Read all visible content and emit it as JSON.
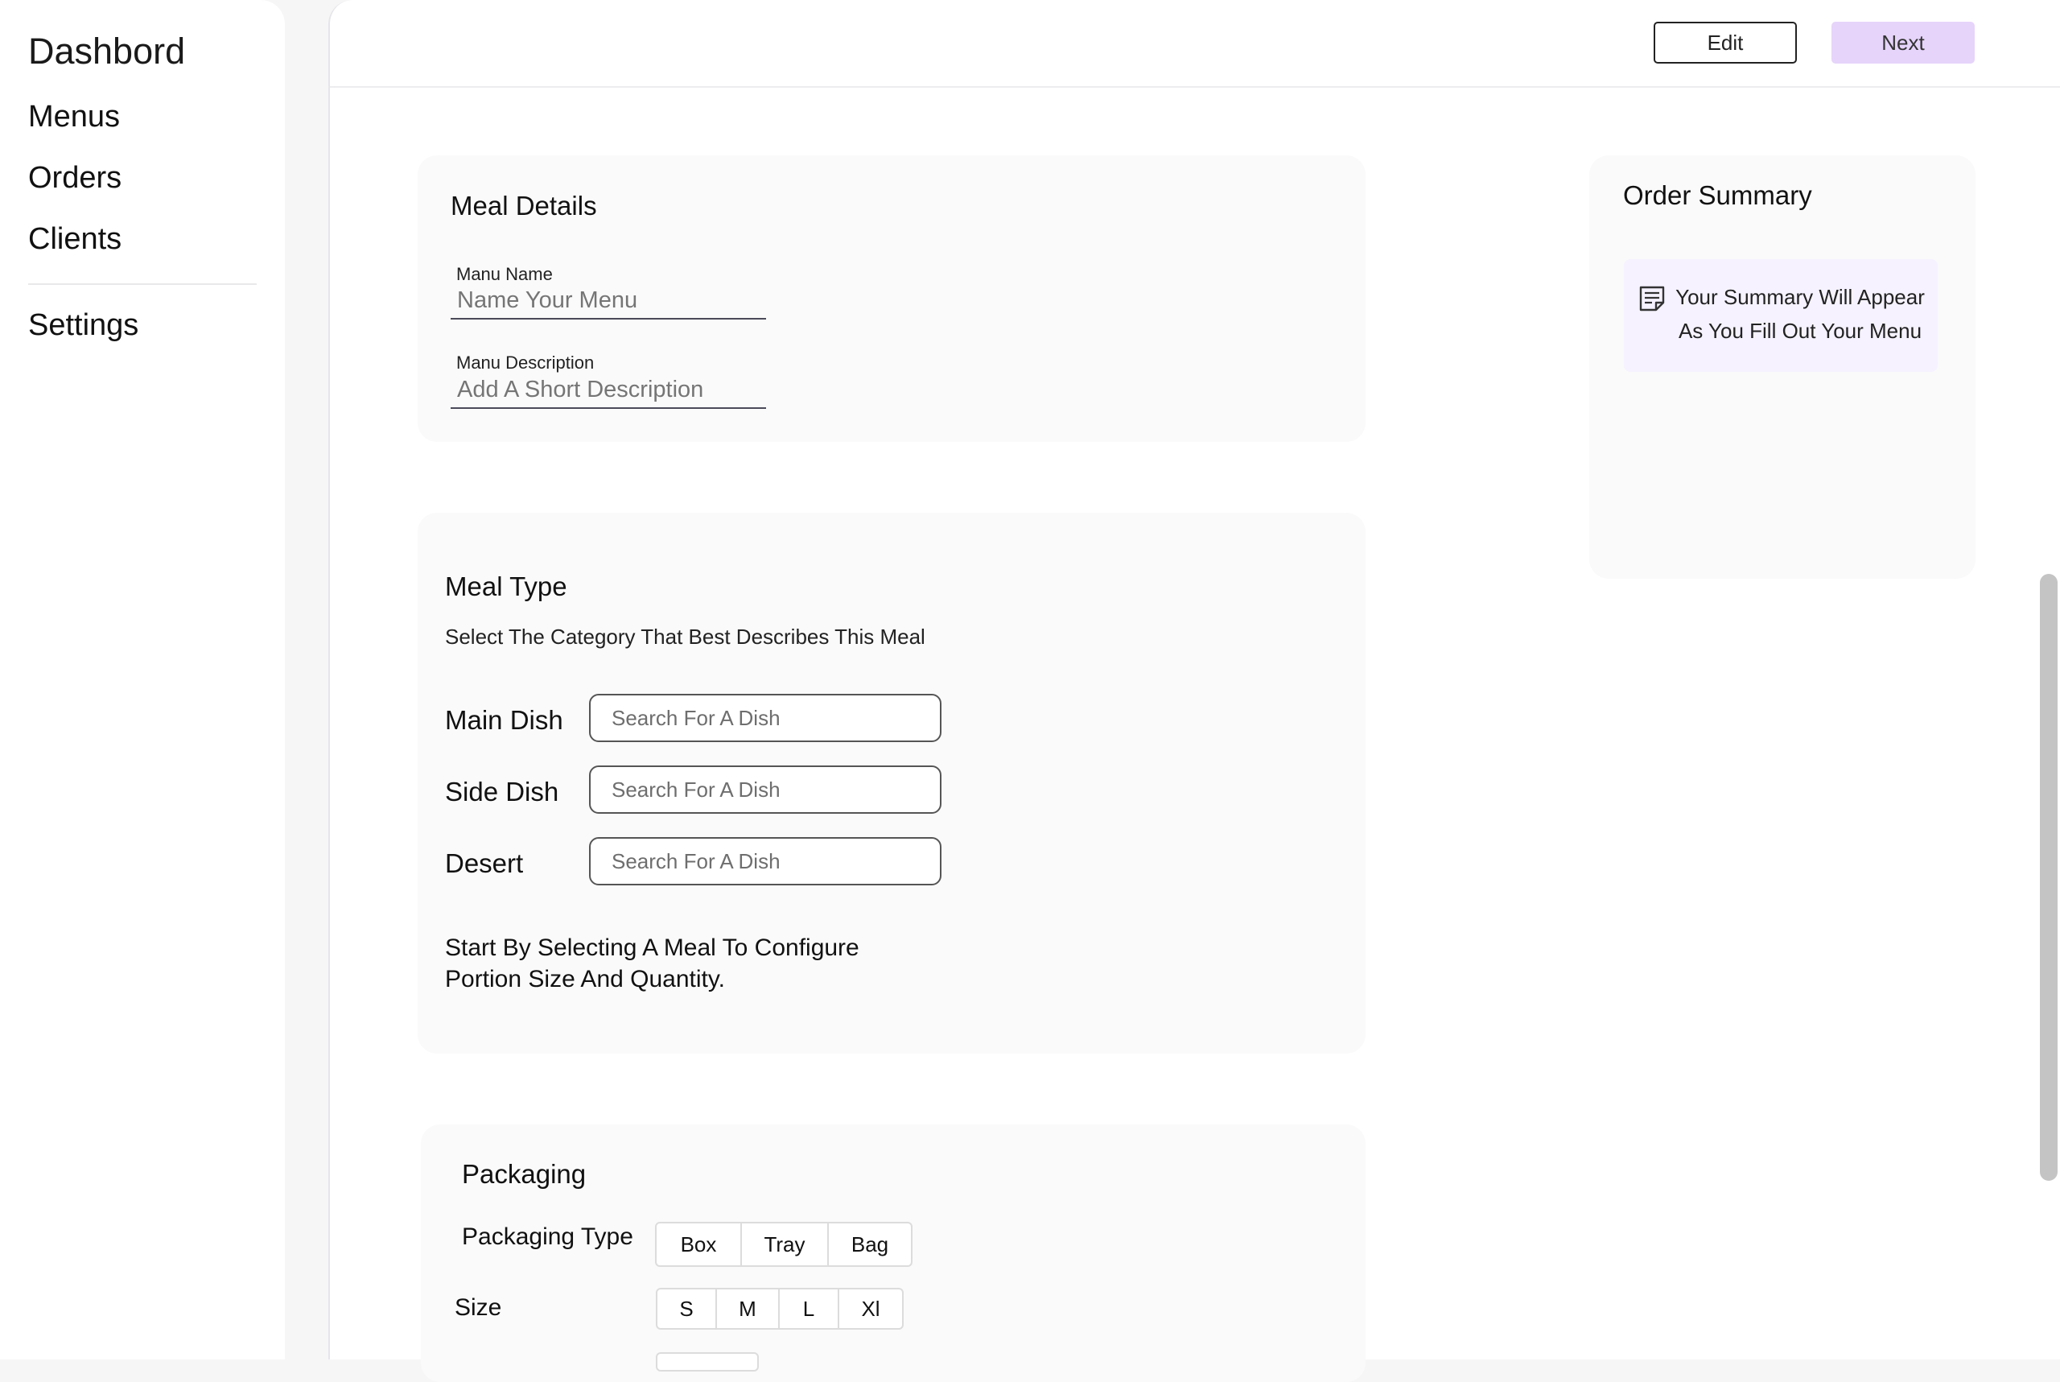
{
  "sidebar": {
    "brand": "Dashbord",
    "items": [
      {
        "label": "Menus"
      },
      {
        "label": "Orders"
      },
      {
        "label": "Clients"
      },
      {
        "label": "Settings"
      }
    ]
  },
  "toolbar": {
    "edit_label": "Edit",
    "next_label": "Next",
    "next_color": "#e6d4fa"
  },
  "meal_details": {
    "title": "Meal Details",
    "name_label": "Manu Name",
    "name_placeholder": "Name Your Menu",
    "desc_label": "Manu Description",
    "desc_placeholder": "Add A Short Description"
  },
  "meal_type": {
    "title": "Meal Type",
    "subtitle": "Select The Category That Best Describes This Meal",
    "dishes": [
      {
        "label": "Main Dish",
        "placeholder": "Search For A Dish"
      },
      {
        "label": "Side Dish",
        "placeholder": "Search For A Dish"
      },
      {
        "label": "Desert",
        "placeholder": "Search For A Dish"
      }
    ],
    "help_text": "Start By Selecting A Meal To Configure Portion Size And Quantity."
  },
  "packaging": {
    "title": "Packaging",
    "type_label": "Packaging Type",
    "type_options": [
      "Box",
      "Tray",
      "Bag"
    ],
    "size_label": "Size",
    "size_options": [
      "S",
      "M",
      "L",
      "Xl"
    ]
  },
  "order_summary": {
    "title": "Order Summary",
    "icon": "note-icon",
    "empty_text": "Your Summary Will Appear As You Fill Out Your Menu"
  }
}
